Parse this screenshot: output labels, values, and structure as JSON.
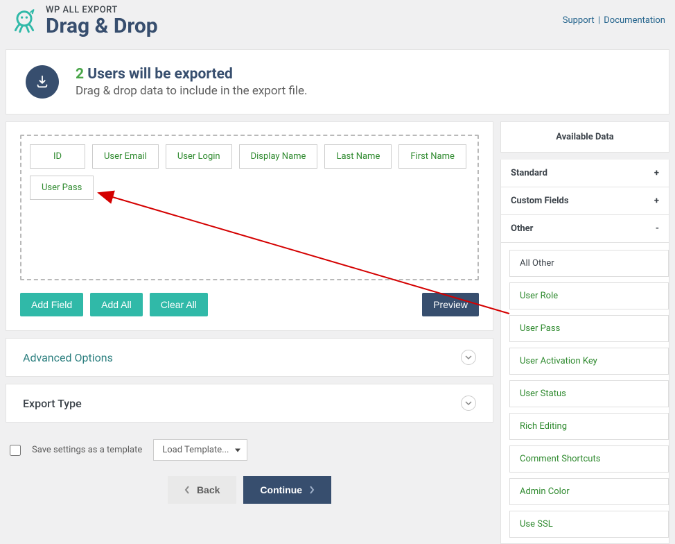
{
  "brand": {
    "top": "WP ALL EXPORT",
    "main": "Drag & Drop"
  },
  "header_links": {
    "support": "Support",
    "documentation": "Documentation"
  },
  "info": {
    "count": "2",
    "title_rest": " Users will be exported",
    "subtitle": "Drag & drop data to include in the export file."
  },
  "dropzone_fields": [
    "ID",
    "User Email",
    "User Login",
    "Display Name",
    "Last Name",
    "First Name",
    "User Pass"
  ],
  "buttons": {
    "add_field": "Add Field",
    "add_all": "Add All",
    "clear_all": "Clear All",
    "preview": "Preview",
    "back": "Back",
    "continue": "Continue"
  },
  "sections": {
    "advanced": "Advanced Options",
    "export_type": "Export Type"
  },
  "save_row": {
    "label": "Save settings as a template",
    "select": "Load Template..."
  },
  "sidebar": {
    "title": "Available Data",
    "groups": {
      "standard": {
        "label": "Standard",
        "symbol": "+"
      },
      "custom": {
        "label": "Custom Fields",
        "symbol": "+"
      },
      "other": {
        "label": "Other",
        "symbol": "-"
      }
    },
    "other_items": [
      "All Other",
      "User Role",
      "User Pass",
      "User Activation Key",
      "User Status",
      "Rich Editing",
      "Comment Shortcuts",
      "Admin Color",
      "Use SSL"
    ]
  }
}
